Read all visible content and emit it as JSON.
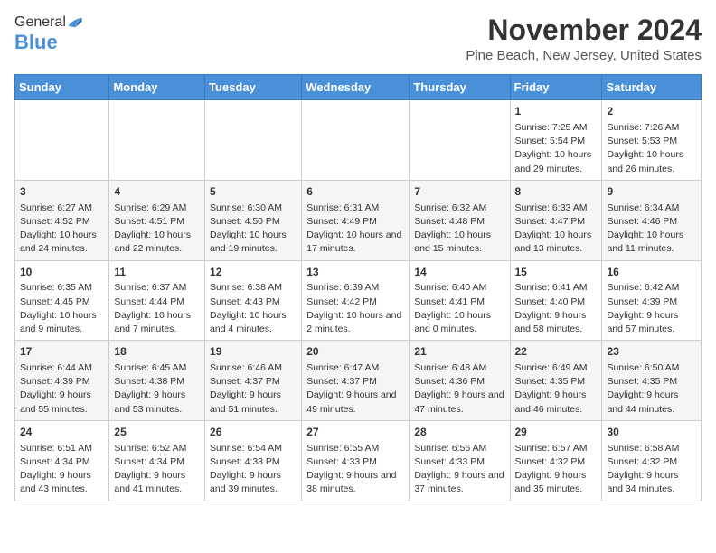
{
  "header": {
    "logo_general": "General",
    "logo_blue": "Blue",
    "title": "November 2024",
    "subtitle": "Pine Beach, New Jersey, United States"
  },
  "calendar": {
    "days_of_week": [
      "Sunday",
      "Monday",
      "Tuesday",
      "Wednesday",
      "Thursday",
      "Friday",
      "Saturday"
    ],
    "weeks": [
      [
        {
          "day": "",
          "info": ""
        },
        {
          "day": "",
          "info": ""
        },
        {
          "day": "",
          "info": ""
        },
        {
          "day": "",
          "info": ""
        },
        {
          "day": "",
          "info": ""
        },
        {
          "day": "1",
          "info": "Sunrise: 7:25 AM\nSunset: 5:54 PM\nDaylight: 10 hours and 29 minutes."
        },
        {
          "day": "2",
          "info": "Sunrise: 7:26 AM\nSunset: 5:53 PM\nDaylight: 10 hours and 26 minutes."
        }
      ],
      [
        {
          "day": "3",
          "info": "Sunrise: 6:27 AM\nSunset: 4:52 PM\nDaylight: 10 hours and 24 minutes."
        },
        {
          "day": "4",
          "info": "Sunrise: 6:29 AM\nSunset: 4:51 PM\nDaylight: 10 hours and 22 minutes."
        },
        {
          "day": "5",
          "info": "Sunrise: 6:30 AM\nSunset: 4:50 PM\nDaylight: 10 hours and 19 minutes."
        },
        {
          "day": "6",
          "info": "Sunrise: 6:31 AM\nSunset: 4:49 PM\nDaylight: 10 hours and 17 minutes."
        },
        {
          "day": "7",
          "info": "Sunrise: 6:32 AM\nSunset: 4:48 PM\nDaylight: 10 hours and 15 minutes."
        },
        {
          "day": "8",
          "info": "Sunrise: 6:33 AM\nSunset: 4:47 PM\nDaylight: 10 hours and 13 minutes."
        },
        {
          "day": "9",
          "info": "Sunrise: 6:34 AM\nSunset: 4:46 PM\nDaylight: 10 hours and 11 minutes."
        }
      ],
      [
        {
          "day": "10",
          "info": "Sunrise: 6:35 AM\nSunset: 4:45 PM\nDaylight: 10 hours and 9 minutes."
        },
        {
          "day": "11",
          "info": "Sunrise: 6:37 AM\nSunset: 4:44 PM\nDaylight: 10 hours and 7 minutes."
        },
        {
          "day": "12",
          "info": "Sunrise: 6:38 AM\nSunset: 4:43 PM\nDaylight: 10 hours and 4 minutes."
        },
        {
          "day": "13",
          "info": "Sunrise: 6:39 AM\nSunset: 4:42 PM\nDaylight: 10 hours and 2 minutes."
        },
        {
          "day": "14",
          "info": "Sunrise: 6:40 AM\nSunset: 4:41 PM\nDaylight: 10 hours and 0 minutes."
        },
        {
          "day": "15",
          "info": "Sunrise: 6:41 AM\nSunset: 4:40 PM\nDaylight: 9 hours and 58 minutes."
        },
        {
          "day": "16",
          "info": "Sunrise: 6:42 AM\nSunset: 4:39 PM\nDaylight: 9 hours and 57 minutes."
        }
      ],
      [
        {
          "day": "17",
          "info": "Sunrise: 6:44 AM\nSunset: 4:39 PM\nDaylight: 9 hours and 55 minutes."
        },
        {
          "day": "18",
          "info": "Sunrise: 6:45 AM\nSunset: 4:38 PM\nDaylight: 9 hours and 53 minutes."
        },
        {
          "day": "19",
          "info": "Sunrise: 6:46 AM\nSunset: 4:37 PM\nDaylight: 9 hours and 51 minutes."
        },
        {
          "day": "20",
          "info": "Sunrise: 6:47 AM\nSunset: 4:37 PM\nDaylight: 9 hours and 49 minutes."
        },
        {
          "day": "21",
          "info": "Sunrise: 6:48 AM\nSunset: 4:36 PM\nDaylight: 9 hours and 47 minutes."
        },
        {
          "day": "22",
          "info": "Sunrise: 6:49 AM\nSunset: 4:35 PM\nDaylight: 9 hours and 46 minutes."
        },
        {
          "day": "23",
          "info": "Sunrise: 6:50 AM\nSunset: 4:35 PM\nDaylight: 9 hours and 44 minutes."
        }
      ],
      [
        {
          "day": "24",
          "info": "Sunrise: 6:51 AM\nSunset: 4:34 PM\nDaylight: 9 hours and 43 minutes."
        },
        {
          "day": "25",
          "info": "Sunrise: 6:52 AM\nSunset: 4:34 PM\nDaylight: 9 hours and 41 minutes."
        },
        {
          "day": "26",
          "info": "Sunrise: 6:54 AM\nSunset: 4:33 PM\nDaylight: 9 hours and 39 minutes."
        },
        {
          "day": "27",
          "info": "Sunrise: 6:55 AM\nSunset: 4:33 PM\nDaylight: 9 hours and 38 minutes."
        },
        {
          "day": "28",
          "info": "Sunrise: 6:56 AM\nSunset: 4:33 PM\nDaylight: 9 hours and 37 minutes."
        },
        {
          "day": "29",
          "info": "Sunrise: 6:57 AM\nSunset: 4:32 PM\nDaylight: 9 hours and 35 minutes."
        },
        {
          "day": "30",
          "info": "Sunrise: 6:58 AM\nSunset: 4:32 PM\nDaylight: 9 hours and 34 minutes."
        }
      ]
    ]
  }
}
